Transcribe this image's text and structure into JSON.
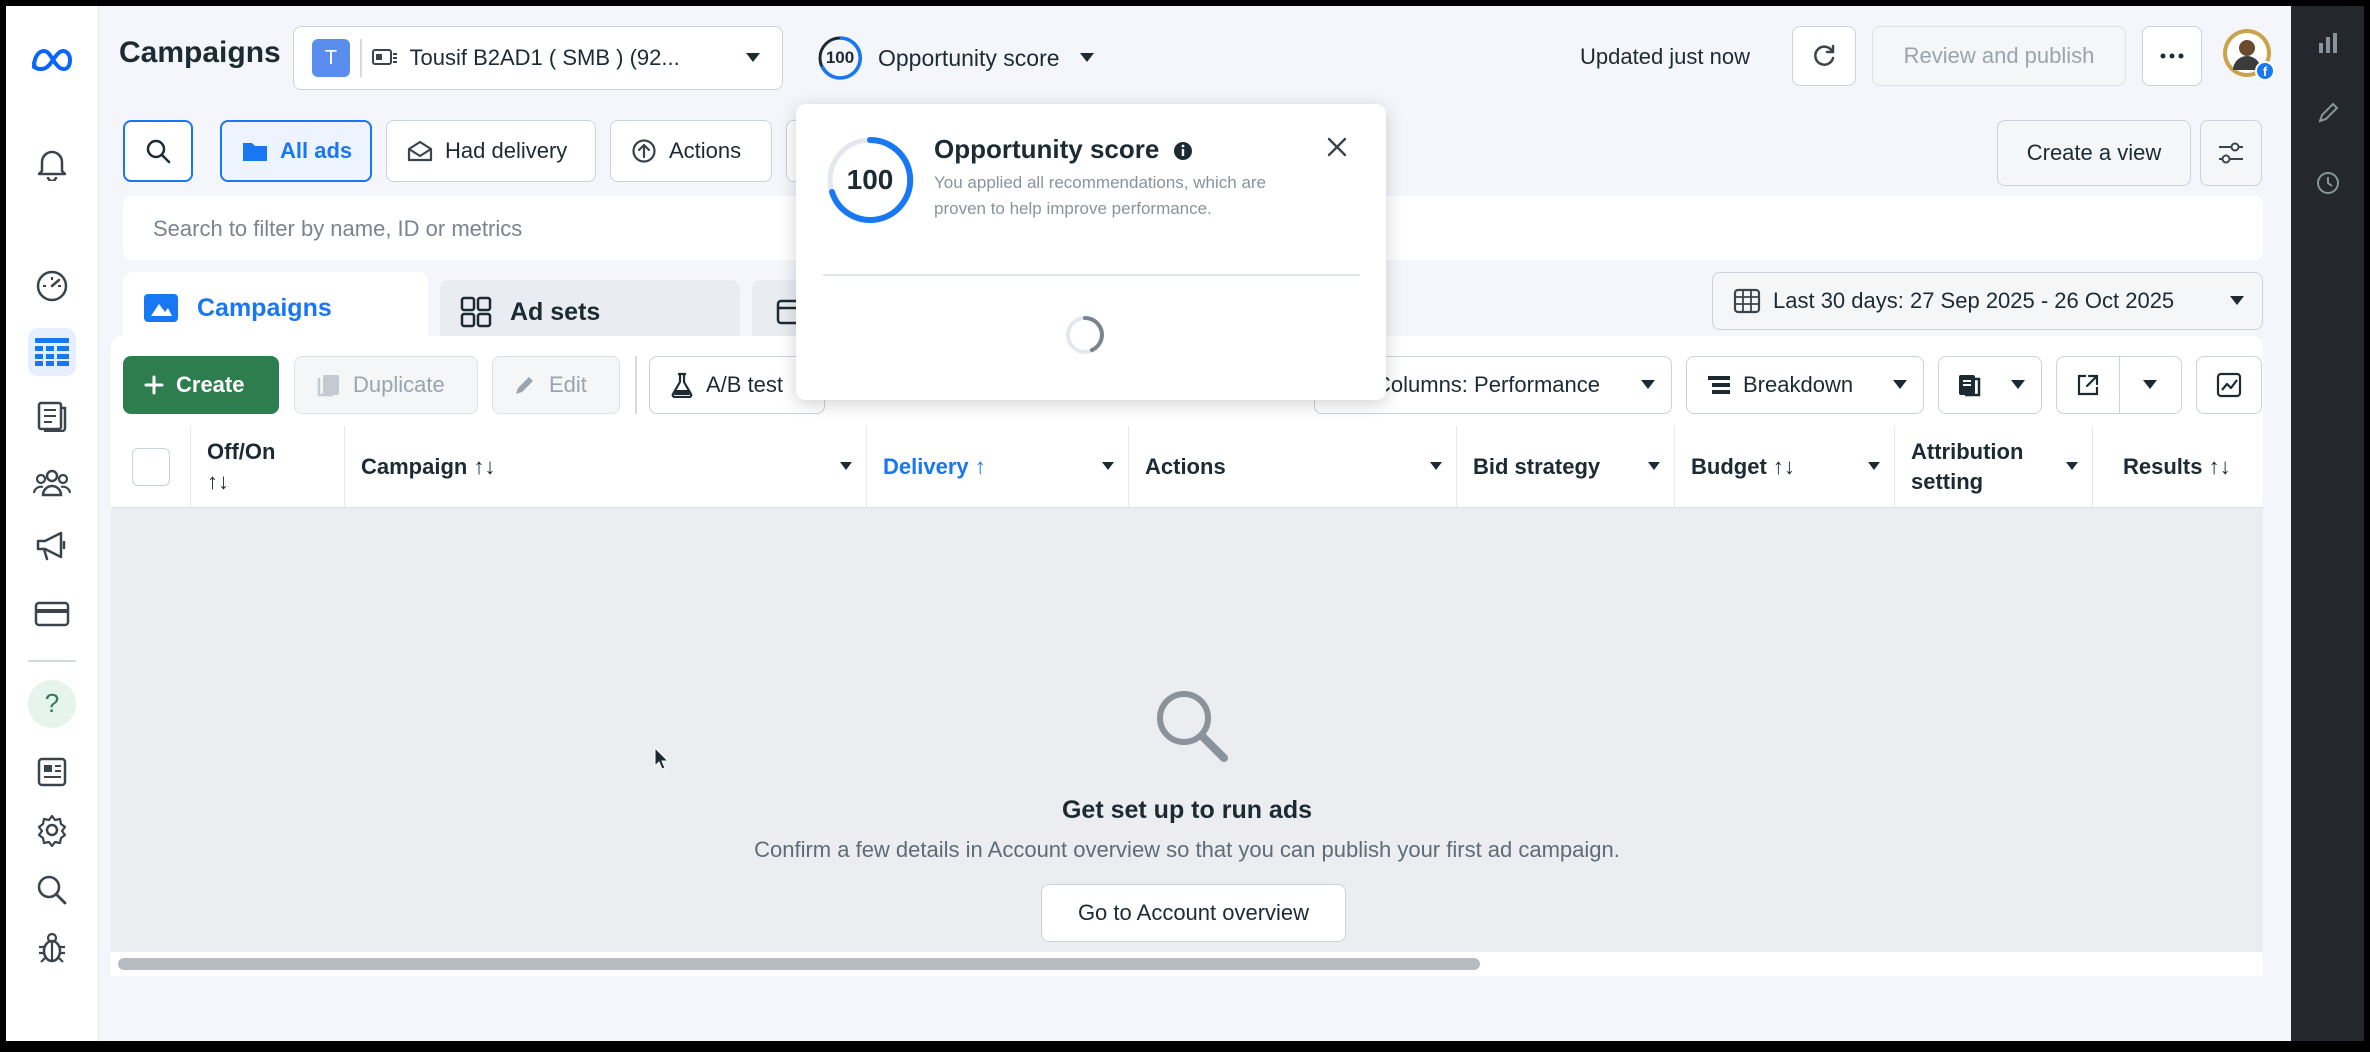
{
  "header": {
    "title": "Campaigns",
    "account": {
      "initial": "T",
      "name": "Tousif B2AD1 ( SMB ) (92..."
    },
    "opportunity": {
      "score": "100",
      "label": "Opportunity score"
    },
    "updated": "Updated just now",
    "review_publish": "Review and publish"
  },
  "filters": {
    "all_ads": "All ads",
    "had_delivery": "Had delivery",
    "actions": "Actions",
    "create_view": "Create a view"
  },
  "search": {
    "placeholder": "Search to filter by name, ID or metrics"
  },
  "tabs": [
    {
      "label": "Campaigns"
    },
    {
      "label": "Ad sets"
    }
  ],
  "date_range": "Last 30 days: 27 Sep 2025 - 26 Oct 2025",
  "toolbar": {
    "create": "Create",
    "duplicate": "Duplicate",
    "edit": "Edit",
    "ab_test": "A/B test",
    "columns": "Columns: Performance",
    "breakdown": "Breakdown"
  },
  "table": {
    "columns": [
      {
        "line1": "Off/On",
        "line2": "↑↓"
      },
      {
        "line1": "Campaign ↑↓",
        "line2": ""
      },
      {
        "line1": "Delivery ↑",
        "line2": ""
      },
      {
        "line1": "Actions",
        "line2": ""
      },
      {
        "line1": "Bid strategy",
        "line2": ""
      },
      {
        "line1": "Budget ↑↓",
        "line2": ""
      },
      {
        "line1": "Attribution",
        "line2": "setting"
      },
      {
        "line1": "Results ↑↓",
        "line2": ""
      }
    ]
  },
  "empty_state": {
    "title": "Get set up to run ads",
    "subtitle": "Confirm a few details in Account overview so that you can publish your first ad campaign.",
    "button": "Go to Account overview"
  },
  "popup": {
    "score": "100",
    "title": "Opportunity score",
    "description": "You applied all recommendations, which are proven to help improve performance."
  },
  "colors": {
    "accent": "#1877f2",
    "create_green": "#2e7d4f",
    "rail": "#24282e"
  }
}
